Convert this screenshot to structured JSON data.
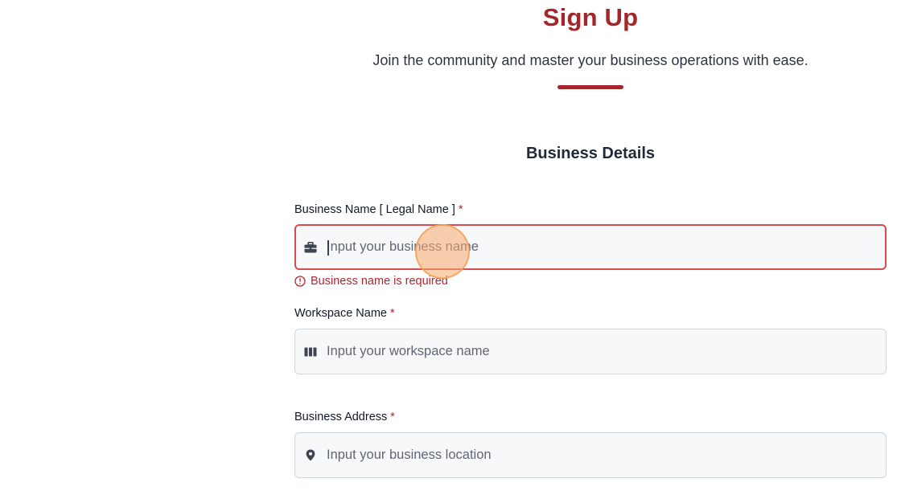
{
  "header": {
    "title": "Sign Up",
    "subtitle": "Join the community and master your business operations with ease."
  },
  "section": {
    "title": "Business Details"
  },
  "fields": {
    "business_name": {
      "label": "Business Name [ Legal Name ]",
      "required_mark": "*",
      "placeholder": "Input your business name",
      "value": "",
      "icon": "briefcase-icon",
      "error": "Business name is required"
    },
    "workspace_name": {
      "label": "Workspace Name",
      "required_mark": "*",
      "placeholder": "Input your workspace name",
      "value": "",
      "icon": "columns-icon"
    },
    "business_address": {
      "label": "Business Address",
      "required_mark": "*",
      "placeholder": "Input your business location",
      "value": "",
      "icon": "map-pin-icon"
    }
  },
  "colors": {
    "brand": "#a4262c",
    "error": "#b3262d",
    "error_border": "#d94b4f",
    "input_bg": "#f7f8fa",
    "click_marker": "#f8aa6e"
  }
}
